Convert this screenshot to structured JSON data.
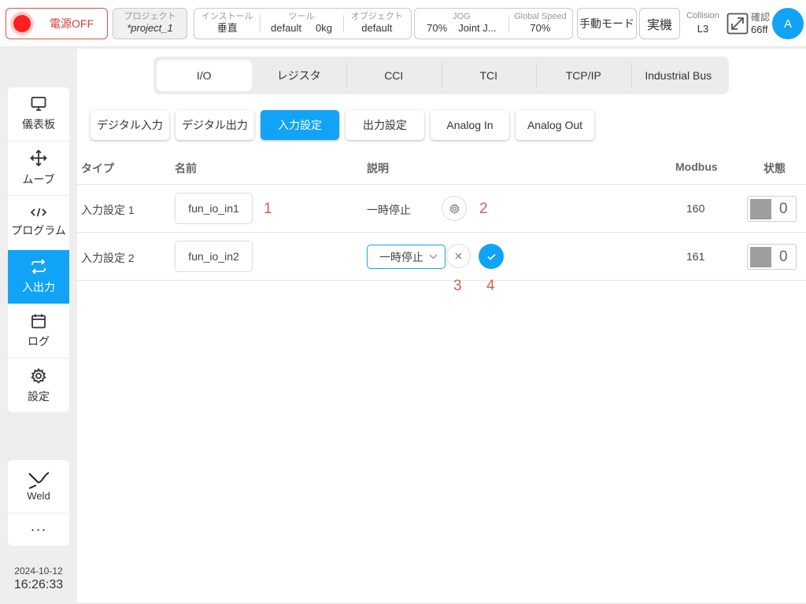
{
  "topbar": {
    "power_label": "電源OFF",
    "project": {
      "label": "プロジェクト",
      "value": "*project_1"
    },
    "install": {
      "label": "インストール",
      "value": "垂直"
    },
    "tool": {
      "label": "ツール",
      "name": "default",
      "weight": "0kg"
    },
    "object": {
      "label": "オブジェクト",
      "value": "default"
    },
    "jog": {
      "label": "JOG",
      "speed": "70%",
      "mode": "Joint J..."
    },
    "global_speed": {
      "label": "Global Speed",
      "value": "70%"
    },
    "manual_mode_label": "手動モード",
    "real_label": "実機",
    "collision": {
      "label": "Collision",
      "value": "L3"
    },
    "confirm": {
      "label": "確認",
      "value": "66ff"
    },
    "avatar_letter": "A"
  },
  "sidenav": {
    "items": [
      {
        "label": "儀表板",
        "icon": "monitor-icon"
      },
      {
        "label": "ムーブ",
        "icon": "move-icon"
      },
      {
        "label": "プログラム",
        "icon": "code-icon"
      },
      {
        "label": "入出力",
        "icon": "io-arrows-icon"
      },
      {
        "label": "ログ",
        "icon": "calendar-icon"
      },
      {
        "label": "設定",
        "icon": "gear-icon"
      }
    ],
    "active": "入出力",
    "weld_label": "Weld",
    "more_label": "···"
  },
  "clock": {
    "date": "2024-10-12",
    "time": "16:26:33"
  },
  "tabs": [
    "I/O",
    "レジスタ",
    "CCI",
    "TCI",
    "TCP/IP",
    "Industrial Bus"
  ],
  "active_tab": "I/O",
  "subtabs": [
    "デジタル入力",
    "デジタル出力",
    "入力設定",
    "出力設定",
    "Analog In",
    "Analog Out"
  ],
  "active_subtab": "入力設定",
  "table": {
    "headers": {
      "type": "タイプ",
      "name": "名前",
      "description": "説明",
      "modbus": "Modbus",
      "state": "状態"
    },
    "rows": [
      {
        "type": "入力設定 1",
        "name": "fun_io_in1",
        "description": "一時停止",
        "modbus": "160",
        "state": "0"
      },
      {
        "type": "入力設定 2",
        "name": "fun_io_in2",
        "description": "一時停止",
        "modbus": "161",
        "state": "0"
      }
    ]
  },
  "markers": [
    "1",
    "2",
    "3",
    "4"
  ],
  "colors": {
    "accent": "#11a3f5",
    "power_red": "#ff1f1f",
    "marker_red": "#e15a50"
  }
}
